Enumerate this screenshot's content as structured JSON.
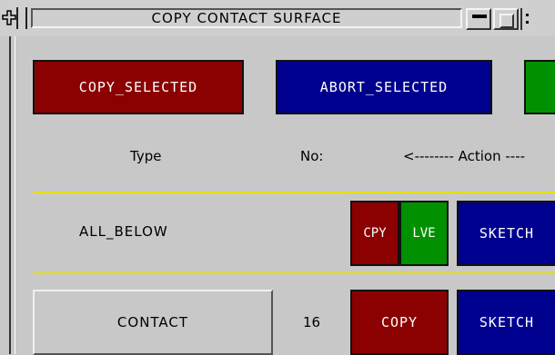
{
  "window": {
    "title": "COPY CONTACT SURFACE"
  },
  "toolbar": {
    "copy_selected": "COPY_SELECTED",
    "abort_selected": "ABORT_SELECTED"
  },
  "table": {
    "headers": {
      "type": "Type",
      "no": "No:",
      "action": "<-------- Action ----"
    },
    "all_below": {
      "label": "ALL_BELOW",
      "cpy": "CPY",
      "lve": "LVE",
      "sketch": "SKETCH"
    },
    "rows": [
      {
        "type": "CONTACT",
        "no": "16",
        "copy": "COPY",
        "sketch": "SKETCH"
      }
    ]
  },
  "colors": {
    "red": "#8b0000",
    "blue": "#00008f",
    "green": "#009000",
    "yellow_separator": "#e6e000",
    "panel": "#c8c8c8"
  },
  "icons": [
    "move-icon",
    "minimize-icon",
    "maximize-icon"
  ]
}
